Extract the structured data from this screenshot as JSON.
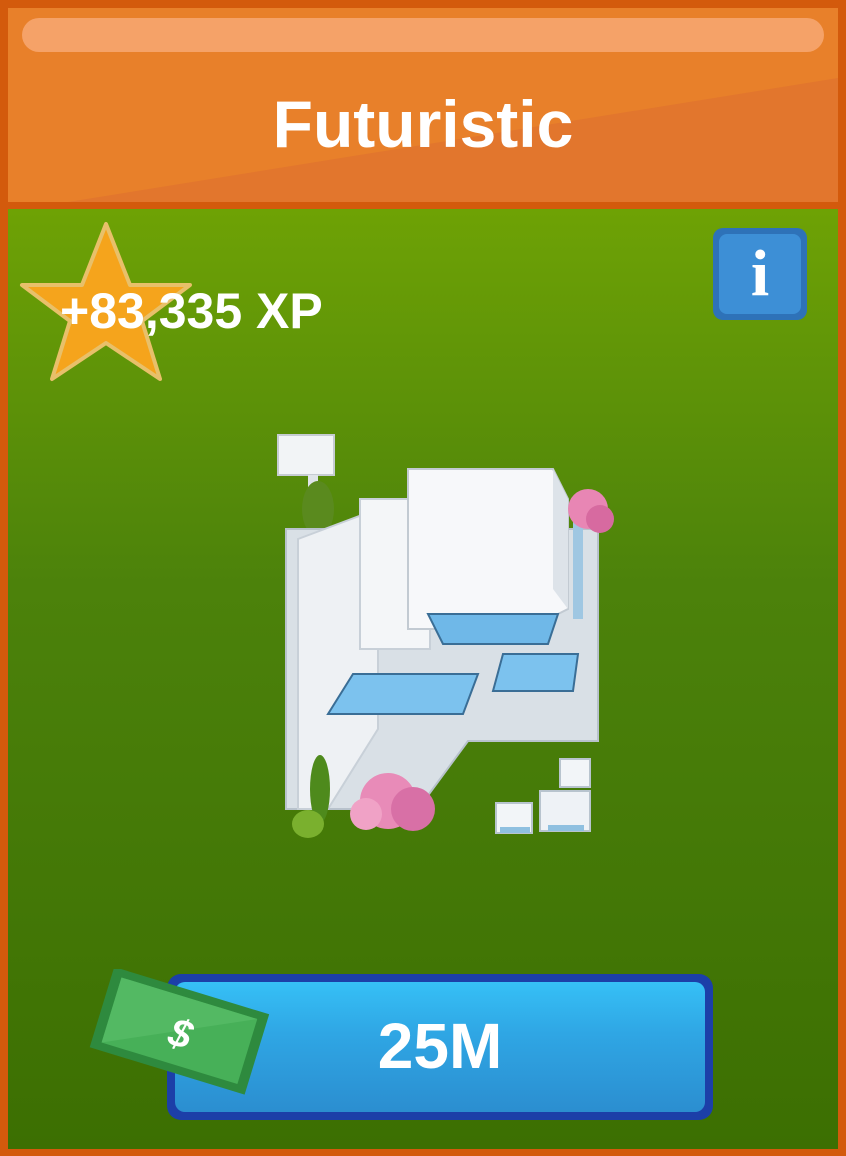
{
  "item": {
    "title": "Futuristic",
    "xp": "+83,335 XP",
    "price": "25M"
  },
  "icons": {
    "star": "star-icon",
    "info": "info-icon",
    "info_glyph": "i",
    "cash": "dollar-bill-icon",
    "cash_glyph": "$",
    "building": "futuristic-building-icon"
  },
  "colors": {
    "frame": "#d35a0c",
    "header": "#e8802a",
    "body_top": "#6ea205",
    "body_bottom": "#3c6f02",
    "star": "#f5a41c",
    "info": "#3d8fd6",
    "buy_button": "#2fa6e4",
    "cash": "#2f9e4a"
  }
}
